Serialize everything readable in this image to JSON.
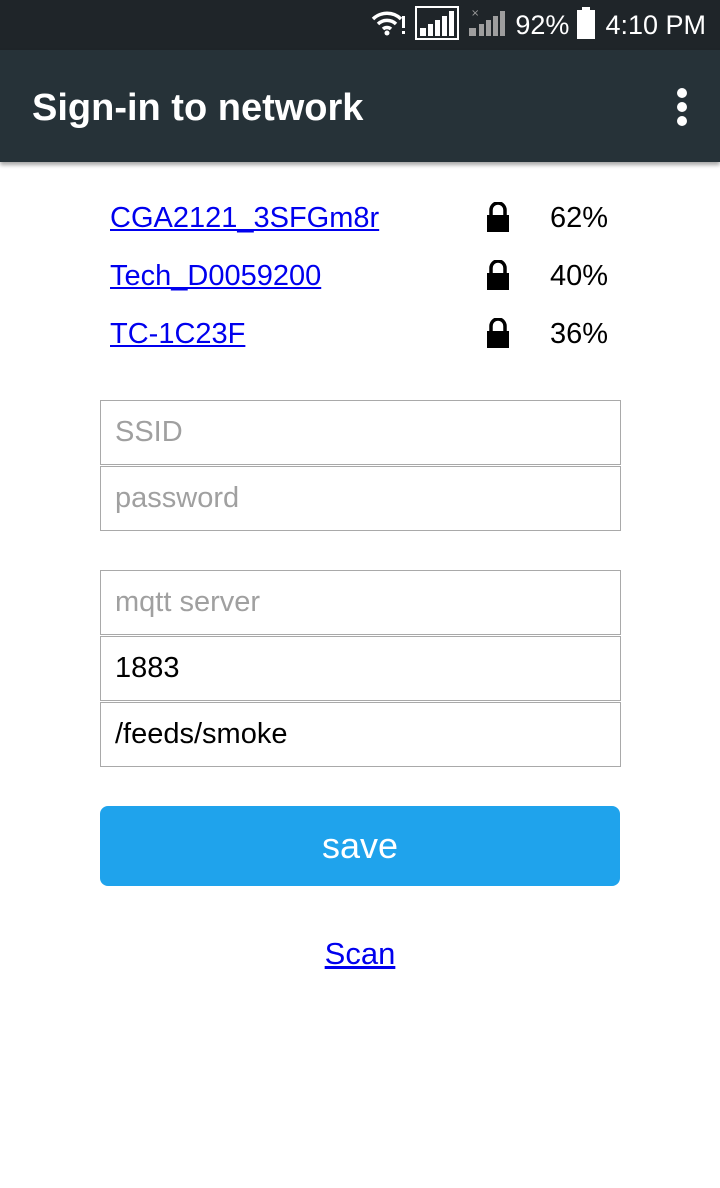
{
  "status_bar": {
    "battery_percent": "92%",
    "time": "4:10 PM",
    "icons": [
      "wifi-alert-icon",
      "sim1-signal-icon",
      "sim2-no-signal-icon",
      "battery-icon"
    ]
  },
  "app_bar": {
    "title": "Sign-in to network",
    "menu_icon": "overflow-menu-icon"
  },
  "networks": [
    {
      "ssid": "CGA2121_3SFGm8r",
      "signal": "62%",
      "secured": true
    },
    {
      "ssid": "Tech_D0059200",
      "signal": "40%",
      "secured": true
    },
    {
      "ssid": "TC-1C23F",
      "signal": "36%",
      "secured": true
    }
  ],
  "form": {
    "ssid": {
      "placeholder": "SSID",
      "value": ""
    },
    "password": {
      "placeholder": "password",
      "value": ""
    },
    "mqtt_server": {
      "placeholder": "mqtt server",
      "value": ""
    },
    "port": {
      "placeholder": "",
      "value": "1883"
    },
    "topic": {
      "placeholder": "",
      "value": "/feeds/smoke"
    },
    "save_label": "save"
  },
  "scan_label": "Scan",
  "colors": {
    "status_bar": "#1f2529",
    "app_bar": "#263238",
    "button": "#1fa3ec",
    "link": "#0000ee"
  }
}
